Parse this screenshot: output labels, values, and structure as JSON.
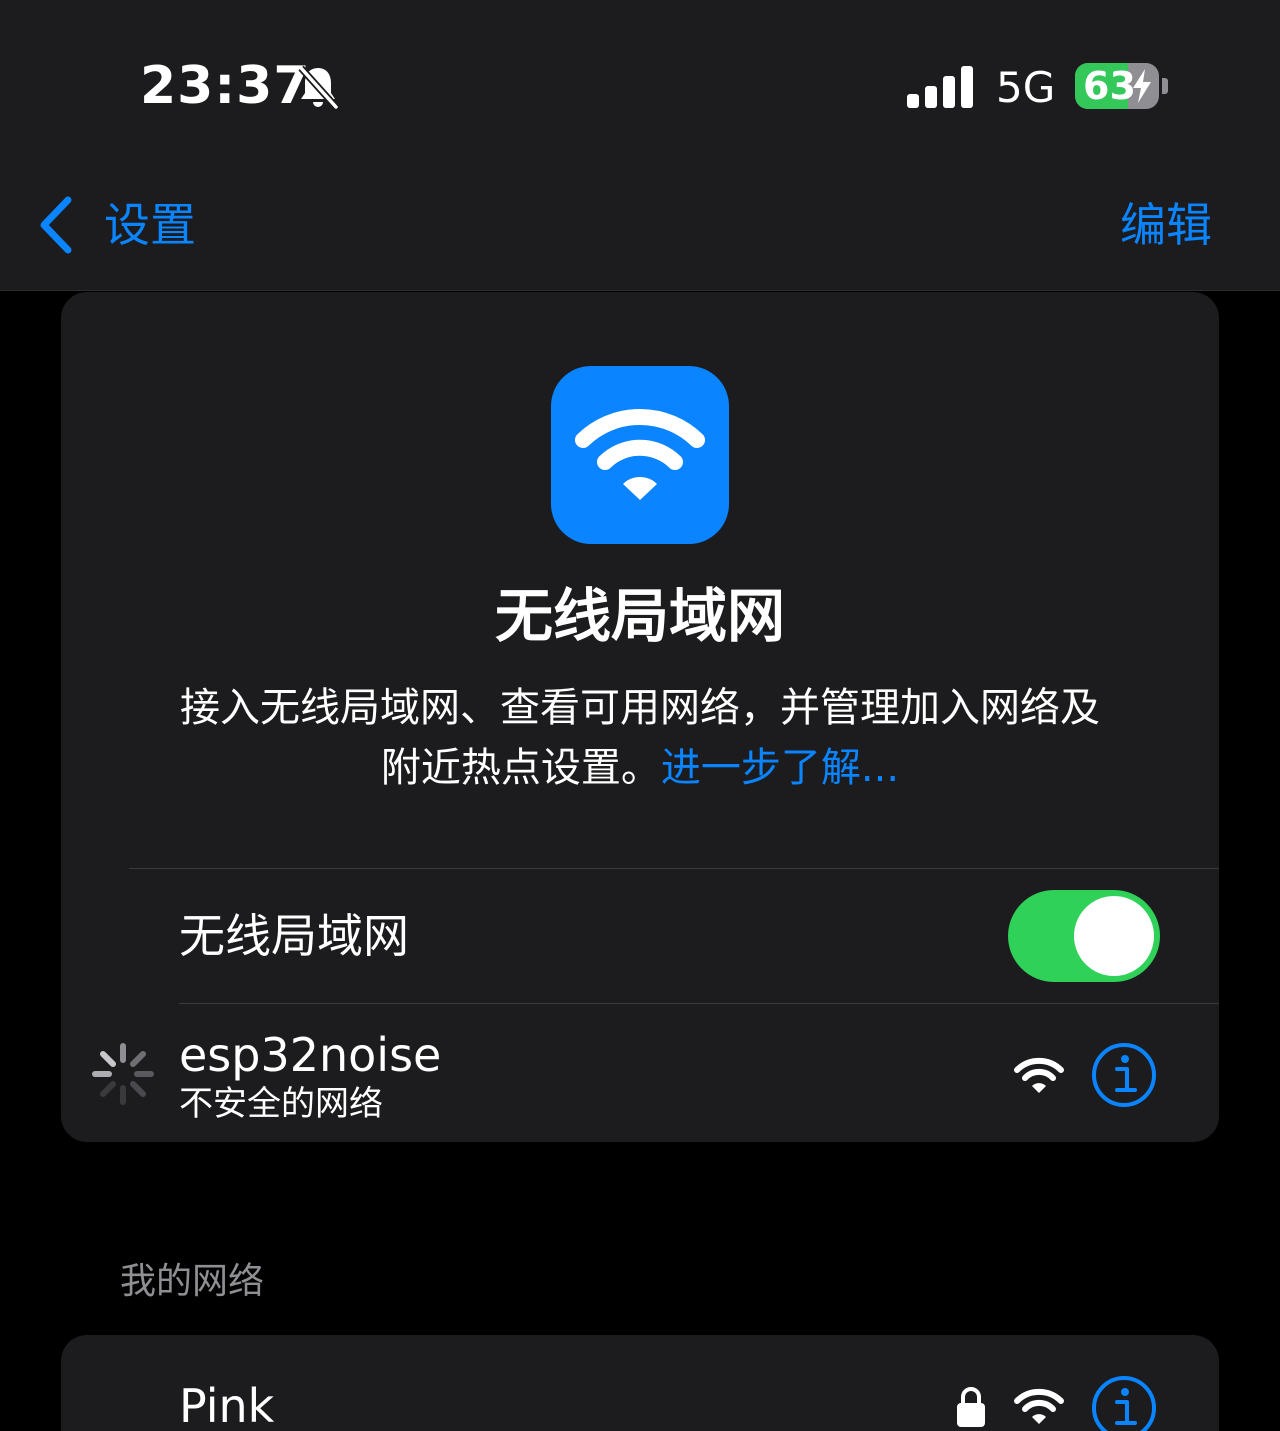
{
  "status_bar": {
    "time": "23:37",
    "mute_icon": "bell-slash-icon",
    "signal_icon": "cellular-signal-icon",
    "network_type": "5G",
    "battery_level": "63",
    "battery_percent": 63,
    "battery_charging": true,
    "battery_color": "#34c759"
  },
  "nav": {
    "back_label": "设置",
    "edit_label": "编辑",
    "accent_color": "#0a84ff"
  },
  "wifi_card": {
    "icon": "wifi-icon",
    "title": "无线局域网",
    "description_line1": "接入无线局域网、查看可用网络，并管理加入网络及",
    "description_line2": "附近热点设置。",
    "learn_more": "进一步了解...",
    "toggle_label": "无线局域网",
    "toggle_on": true,
    "toggle_color": "#30d158"
  },
  "current_network": {
    "name": "esp32noise",
    "subtitle": "不安全的网络",
    "connecting_icon": "spinner-icon",
    "signal_icon": "wifi-signal-icon",
    "info_icon": "info-icon"
  },
  "my_networks": {
    "header": "我的网络",
    "items": [
      {
        "name": "Pink",
        "secured": true,
        "lock_icon": "lock-icon",
        "signal_icon": "wifi-signal-icon",
        "info_icon": "info-icon"
      }
    ]
  }
}
